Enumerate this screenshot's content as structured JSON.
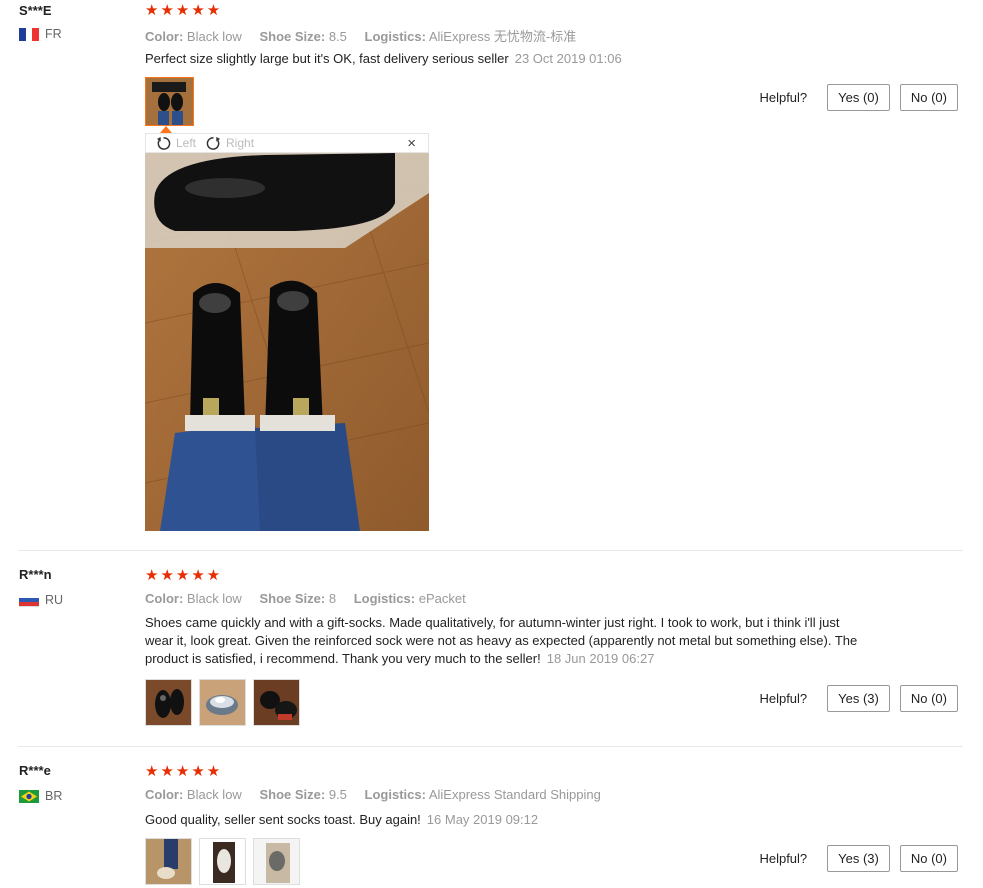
{
  "reviews": [
    {
      "name": "S***E",
      "country": "FR",
      "stars": "★★★★★",
      "color_label": "Color:",
      "color": "Black low",
      "size_label": "Shoe Size:",
      "size": "8.5",
      "logistics_label": "Logistics:",
      "logistics": "AliExpress 无忧物流-标准",
      "text": "Perfect size slightly large but it's OK, fast delivery serious seller",
      "date": "23 Oct 2019 01:06",
      "helpful_label": "Helpful?",
      "yes": "Yes (0)",
      "no": "No (0)"
    },
    {
      "name": "R***n",
      "country": "RU",
      "stars": "★★★★★",
      "color_label": "Color:",
      "color": "Black low",
      "size_label": "Shoe Size:",
      "size": "8",
      "logistics_label": "Logistics:",
      "logistics": "ePacket",
      "text": "Shoes came quickly and with a gift-socks. Made qualitatively, for autumn-winter just right. I took to work, but i think i'll just wear it, look great. Given the reinforced sock were not as heavy as expected (apparently not metal but something else). The product is satisfied, i recommend. Thank you very much to the seller!",
      "date": "18 Jun 2019 06:27",
      "helpful_label": "Helpful?",
      "yes": "Yes (3)",
      "no": "No (0)"
    },
    {
      "name": "R***e",
      "country": "BR",
      "stars": "★★★★★",
      "color_label": "Color:",
      "color": "Black low",
      "size_label": "Shoe Size:",
      "size": "9.5",
      "logistics_label": "Logistics:",
      "logistics": "AliExpress Standard Shipping",
      "text": "Good quality, seller sent socks toast. Buy again!",
      "date": "16 May 2019 09:12",
      "helpful_label": "Helpful?",
      "yes": "Yes (3)",
      "no": "No (0)"
    }
  ],
  "viewer": {
    "left_label": "Left",
    "right_label": "Right",
    "close": "×",
    "rotate_left_icon": "rotate-left-icon",
    "rotate_right_icon": "rotate-right-icon"
  },
  "colors": {
    "star": "#e62e04",
    "active_thumb_border": "#ff7519",
    "muted_text": "#999999"
  }
}
